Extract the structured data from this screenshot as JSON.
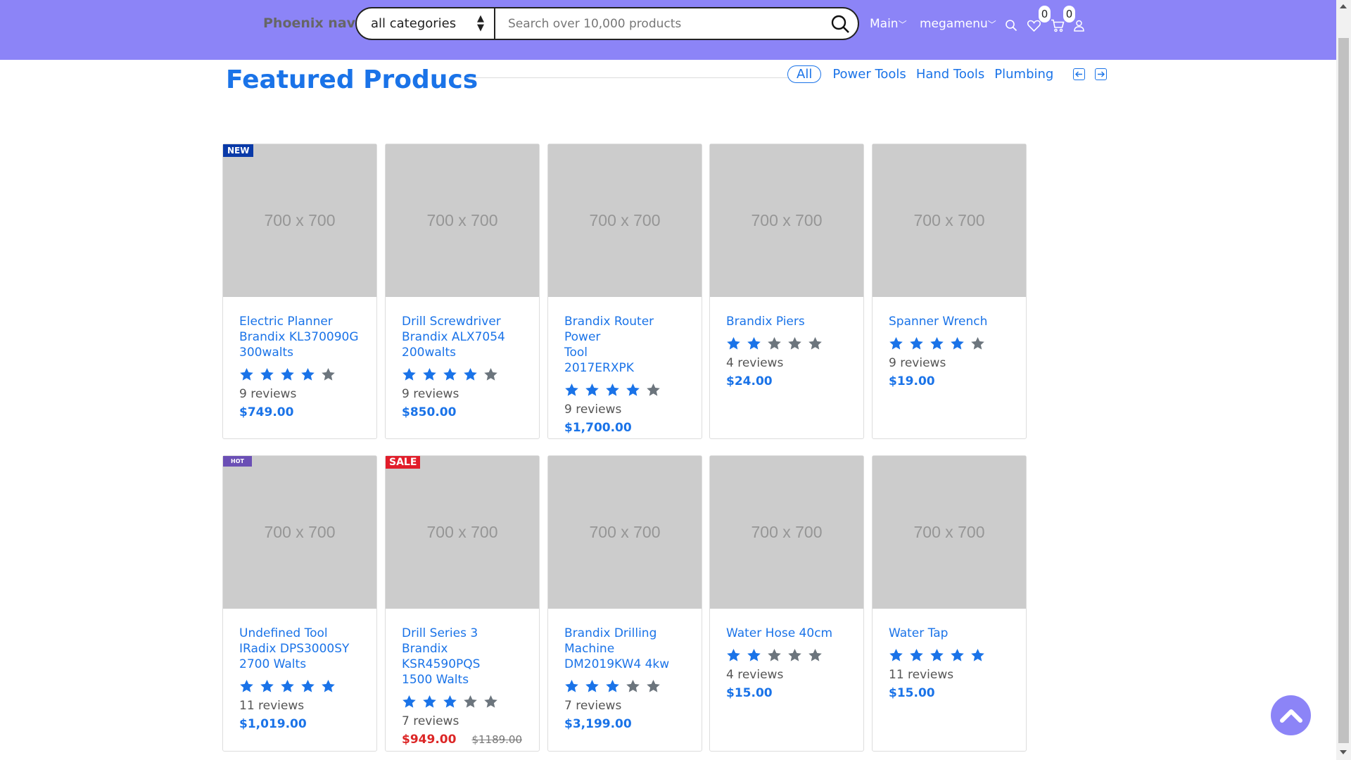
{
  "header": {
    "brand": "Phoenix nav",
    "category_select": "all categories",
    "search_placeholder": "Search over 10,000 products",
    "nav_main": "Main",
    "nav_megamenu": "megamenu",
    "wishlist_count": "0",
    "cart_count": "0",
    "icons": [
      "search-icon",
      "heart-icon",
      "cart-icon",
      "user-icon"
    ],
    "bg_color": "#8c84f7"
  },
  "section": {
    "title": "Featured Producs",
    "filters": [
      "All",
      "Power Tools",
      "Hand Tools",
      "Plumbing"
    ],
    "active_filter": "All"
  },
  "image_placeholder": "700 x 700",
  "products": [
    {
      "name": "Electric Planner\nBrandix KL370090G\n300walts",
      "rating": 4,
      "reviews": "9 reviews",
      "price": "$749.00",
      "label": "NEW"
    },
    {
      "name": "Drill Screwdriver\nBrandix ALX7054\n200walts",
      "rating": 4,
      "reviews": "9 reviews",
      "price": "$850.00"
    },
    {
      "name": "Brandix Router Power\nTool\n2017ERXPK",
      "rating": 4,
      "reviews": "9 reviews",
      "price": "$1,700.00"
    },
    {
      "name": "Brandix Piers",
      "rating": 2,
      "reviews": "4 reviews",
      "price": "$24.00"
    },
    {
      "name": "Spanner Wrench",
      "rating": 4,
      "reviews": "9 reviews",
      "price": "$19.00"
    },
    {
      "name": "Undefined Tool\nIRadix DPS3000SY\n2700 Walts",
      "rating": 5,
      "reviews": "11 reviews",
      "price": "$1,019.00",
      "label": "HOT"
    },
    {
      "name": "Drill Series 3 Brandix\nKSR4590PQS\n1500 Walts",
      "rating": 3,
      "reviews": "7 reviews",
      "price": "$949.00",
      "old_price": "$1189.00",
      "label": "SALE"
    },
    {
      "name": "Brandix Drilling\nMachine\nDM2019KW4 4kw",
      "rating": 3,
      "reviews": "7 reviews",
      "price": "$3,199.00"
    },
    {
      "name": "Water Hose 40cm",
      "rating": 2,
      "reviews": "4 reviews",
      "price": "$15.00"
    },
    {
      "name": "Water Tap",
      "rating": 5,
      "reviews": "11 reviews",
      "price": "$15.00"
    }
  ],
  "colors": {
    "accent": "#1a73e8",
    "star_filled": "#1a73e8",
    "star_empty": "#6c757d",
    "sale_price": "#dc2626",
    "new_label": "#0a3aa8",
    "hot_label": "#6b4fb5",
    "sale_label": "#e11d2a"
  }
}
